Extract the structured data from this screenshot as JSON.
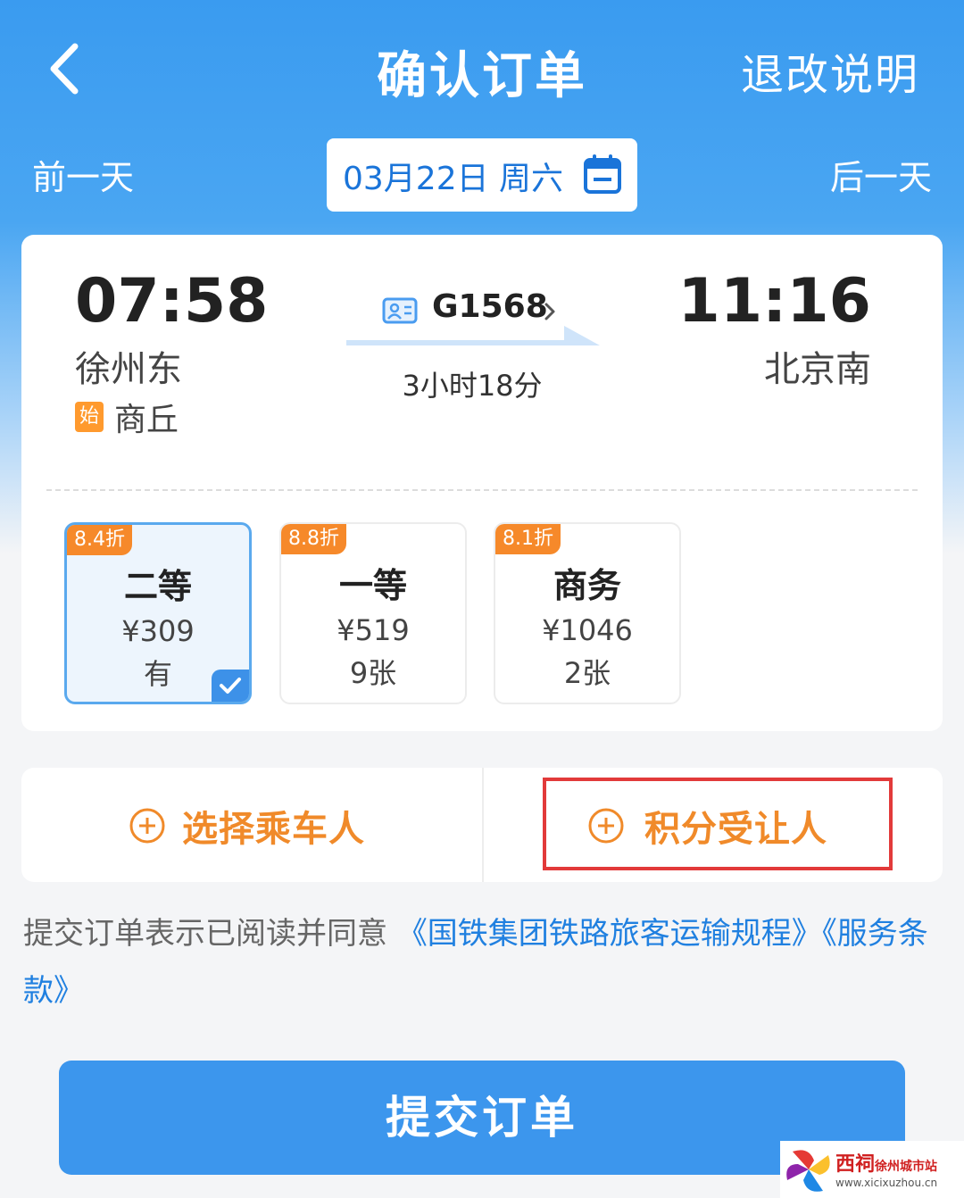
{
  "header": {
    "title": "确认订单",
    "refund_link": "退改说明"
  },
  "date_nav": {
    "prev": "前一天",
    "date": "03月22日 周六",
    "next": "后一天"
  },
  "trip": {
    "departure_time": "07:58",
    "departure_station": "徐州东",
    "origin_badge": "始",
    "origin_station": "商丘",
    "train_number": "G1568",
    "duration": "3小时18分",
    "arrival_time": "11:16",
    "arrival_station": "北京南"
  },
  "seats": [
    {
      "discount": "8.4折",
      "class": "二等",
      "price": "¥309",
      "availability": "有",
      "selected": true
    },
    {
      "discount": "8.8折",
      "class": "一等",
      "price": "¥519",
      "availability": "9张",
      "selected": false
    },
    {
      "discount": "8.1折",
      "class": "商务",
      "price": "¥1046",
      "availability": "2张",
      "selected": false
    }
  ],
  "actions": {
    "choose_passenger": "选择乘车人",
    "points_transferee": "积分受让人"
  },
  "agreement": {
    "text": "提交订单表示已阅读并同意",
    "link1": "《国铁集团铁路旅客运输规程》",
    "link2": "《服务条款》"
  },
  "submit_label": "提交订单",
  "watermark": {
    "name": "西祠",
    "site": "徐州城市站",
    "url": "www.xicixuzhou.cn"
  },
  "colors": {
    "primary_blue": "#3c96ed",
    "accent_orange": "#f08a2a",
    "discount_tag": "#f6892a",
    "highlight_red": "#e23a3a"
  }
}
